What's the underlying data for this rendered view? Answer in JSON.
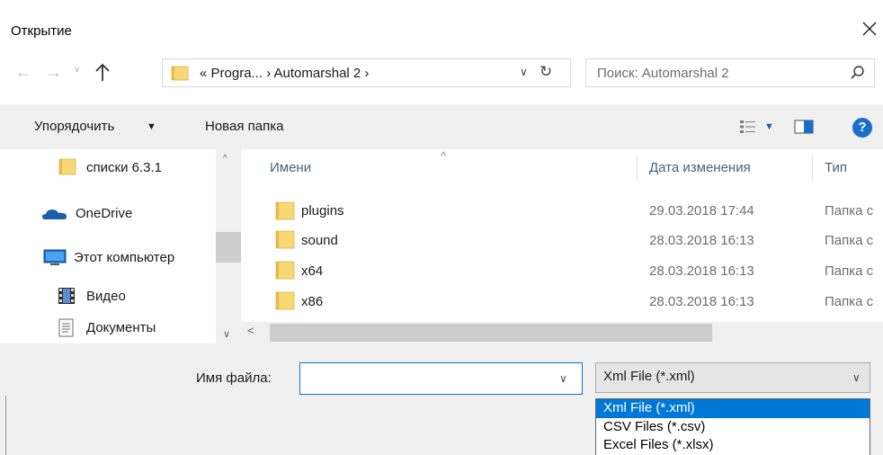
{
  "window": {
    "title": "Открытие",
    "close_glyph": "✕"
  },
  "nav": {
    "back_glyph": "←",
    "forward_glyph": "→",
    "recent_glyph": "∨",
    "up_glyph": "↑"
  },
  "address": {
    "path_text": "« Progra...  ›  Automarshal 2  ›",
    "dropdown_glyph": "∨",
    "refresh_glyph": "↻"
  },
  "search": {
    "placeholder": "Поиск: Automarshal 2"
  },
  "toolbar": {
    "organize_label": "Упорядочить",
    "organize_caret": "▼",
    "new_folder_label": "Новая папка",
    "view_caret": "▼",
    "help_glyph": "?"
  },
  "sidebar": {
    "items": [
      {
        "label": "списки 6.3.1",
        "icon": "folder-icon"
      },
      {
        "label": "OneDrive",
        "icon": "cloud-icon"
      },
      {
        "label": "Этот компьютер",
        "icon": "computer-icon"
      },
      {
        "label": "Видео",
        "icon": "video-icon"
      },
      {
        "label": "Документы",
        "icon": "documents-icon"
      }
    ],
    "scroll_up_glyph": "^",
    "scroll_down_glyph": "∨"
  },
  "filelist": {
    "sort_glyph": "^",
    "columns": {
      "name": "Имени",
      "date": "Дата изменения",
      "type": "Тип"
    },
    "rows": [
      {
        "name": "plugins",
        "date": "29.03.2018 17:44",
        "type": "Папка с"
      },
      {
        "name": "sound",
        "date": "28.03.2018 16:13",
        "type": "Папка с"
      },
      {
        "name": "x64",
        "date": "28.03.2018 16:13",
        "type": "Папка с"
      },
      {
        "name": "x86",
        "date": "28.03.2018 16:13",
        "type": "Папка с"
      }
    ],
    "hscroll_left_glyph": "<"
  },
  "footer": {
    "filename_label": "Имя файла:",
    "filename_value": "",
    "filename_caret": "∨",
    "filetype_selected": "Xml File (*.xml)",
    "filetype_caret": "∨",
    "filetype_options": [
      "Xml File (*.xml)",
      "CSV Files (*.csv)",
      "Excel Files (*.xlsx)"
    ]
  },
  "colors": {
    "accent": "#0078d7",
    "folder": "#f8d775",
    "toolbar_bg": "#f0f0f0"
  }
}
